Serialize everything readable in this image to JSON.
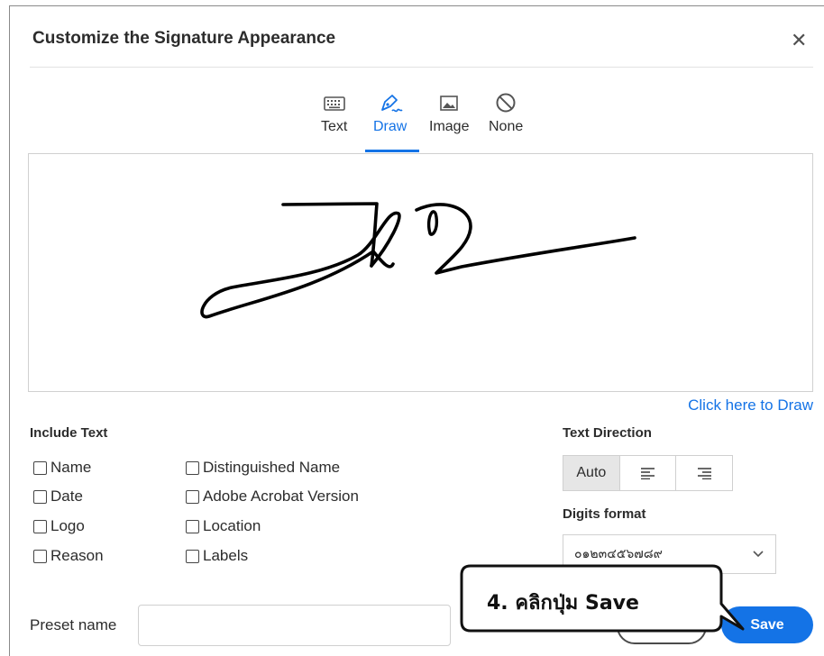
{
  "dialog": {
    "title": "Customize the Signature Appearance",
    "close_icon": "close-icon"
  },
  "tabs": [
    {
      "label": "Text",
      "icon": "keyboard-icon",
      "active": false
    },
    {
      "label": "Draw",
      "icon": "pen-icon",
      "active": true
    },
    {
      "label": "Image",
      "icon": "image-icon",
      "active": false
    },
    {
      "label": "None",
      "icon": "none-icon",
      "active": false
    }
  ],
  "canvas": {
    "draw_link": "Click here to Draw"
  },
  "include_text": {
    "heading": "Include Text",
    "options": [
      {
        "label": "Name",
        "checked": false
      },
      {
        "label": "Date",
        "checked": false
      },
      {
        "label": "Logo",
        "checked": false
      },
      {
        "label": "Reason",
        "checked": false
      },
      {
        "label": "Distinguished Name",
        "checked": false
      },
      {
        "label": "Adobe Acrobat Version",
        "checked": false
      },
      {
        "label": "Location",
        "checked": false
      },
      {
        "label": "Labels",
        "checked": false
      }
    ]
  },
  "text_direction": {
    "heading": "Text Direction",
    "auto_label": "Auto",
    "selected": "Auto"
  },
  "digits_format": {
    "heading": "Digits format",
    "value": "๐๑๒๓๔๕๖๗๘๙"
  },
  "preset": {
    "label": "Preset name",
    "value": ""
  },
  "buttons": {
    "save": "Save",
    "cancel": ""
  },
  "callout": {
    "text": "4. คลิกปุ่ม Save"
  },
  "colors": {
    "accent": "#1473e6",
    "text": "#2c2c2c",
    "border": "#d0d0d0"
  }
}
